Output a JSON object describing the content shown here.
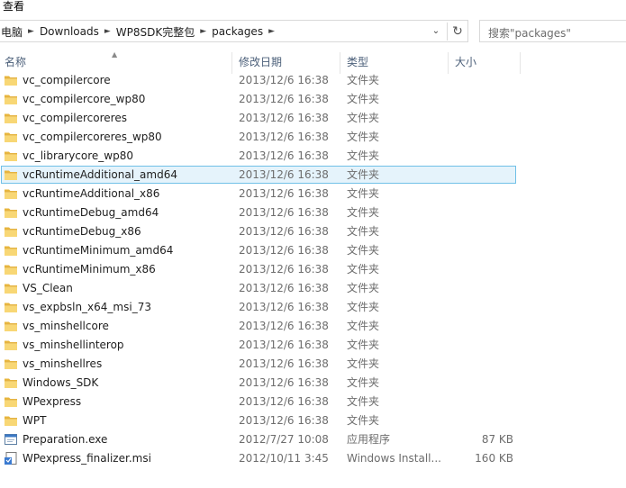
{
  "menu": {
    "view_label": "查看"
  },
  "address": {
    "crumbs": [
      "电脑",
      "Downloads",
      "WP8SDK完整包",
      "packages"
    ],
    "dropdown_icon": "chevron-down-icon",
    "refresh_icon": "refresh-icon"
  },
  "search": {
    "placeholder": "搜索\"packages\""
  },
  "columns": {
    "name": "名称",
    "date": "修改日期",
    "type": "类型",
    "size": "大小"
  },
  "files": [
    {
      "name": "vc_compilercore",
      "date": "2013/12/6 16:38",
      "type": "文件夹",
      "size": "",
      "icon": "folder-icon"
    },
    {
      "name": "vc_compilercore_wp80",
      "date": "2013/12/6 16:38",
      "type": "文件夹",
      "size": "",
      "icon": "folder-icon"
    },
    {
      "name": "vc_compilercoreres",
      "date": "2013/12/6 16:38",
      "type": "文件夹",
      "size": "",
      "icon": "folder-icon"
    },
    {
      "name": "vc_compilercoreres_wp80",
      "date": "2013/12/6 16:38",
      "type": "文件夹",
      "size": "",
      "icon": "folder-icon"
    },
    {
      "name": "vc_librarycore_wp80",
      "date": "2013/12/6 16:38",
      "type": "文件夹",
      "size": "",
      "icon": "folder-icon"
    },
    {
      "name": "vcRuntimeAdditional_amd64",
      "date": "2013/12/6 16:38",
      "type": "文件夹",
      "size": "",
      "icon": "folder-icon",
      "selected": true
    },
    {
      "name": "vcRuntimeAdditional_x86",
      "date": "2013/12/6 16:38",
      "type": "文件夹",
      "size": "",
      "icon": "folder-icon"
    },
    {
      "name": "vcRuntimeDebug_amd64",
      "date": "2013/12/6 16:38",
      "type": "文件夹",
      "size": "",
      "icon": "folder-icon"
    },
    {
      "name": "vcRuntimeDebug_x86",
      "date": "2013/12/6 16:38",
      "type": "文件夹",
      "size": "",
      "icon": "folder-icon"
    },
    {
      "name": "vcRuntimeMinimum_amd64",
      "date": "2013/12/6 16:38",
      "type": "文件夹",
      "size": "",
      "icon": "folder-icon"
    },
    {
      "name": "vcRuntimeMinimum_x86",
      "date": "2013/12/6 16:38",
      "type": "文件夹",
      "size": "",
      "icon": "folder-icon"
    },
    {
      "name": "VS_Clean",
      "date": "2013/12/6 16:38",
      "type": "文件夹",
      "size": "",
      "icon": "folder-icon"
    },
    {
      "name": "vs_expbsln_x64_msi_73",
      "date": "2013/12/6 16:38",
      "type": "文件夹",
      "size": "",
      "icon": "folder-icon"
    },
    {
      "name": "vs_minshellcore",
      "date": "2013/12/6 16:38",
      "type": "文件夹",
      "size": "",
      "icon": "folder-icon"
    },
    {
      "name": "vs_minshellinterop",
      "date": "2013/12/6 16:38",
      "type": "文件夹",
      "size": "",
      "icon": "folder-icon"
    },
    {
      "name": "vs_minshellres",
      "date": "2013/12/6 16:38",
      "type": "文件夹",
      "size": "",
      "icon": "folder-icon"
    },
    {
      "name": "Windows_SDK",
      "date": "2013/12/6 16:38",
      "type": "文件夹",
      "size": "",
      "icon": "folder-icon"
    },
    {
      "name": "WPexpress",
      "date": "2013/12/6 16:38",
      "type": "文件夹",
      "size": "",
      "icon": "folder-icon"
    },
    {
      "name": "WPT",
      "date": "2013/12/6 16:38",
      "type": "文件夹",
      "size": "",
      "icon": "folder-icon"
    },
    {
      "name": "Preparation.exe",
      "date": "2012/7/27 10:08",
      "type": "应用程序",
      "size": "87 KB",
      "icon": "exe-icon"
    },
    {
      "name": "WPexpress_finalizer.msi",
      "date": "2012/10/11 3:45",
      "type": "Windows Install...",
      "size": "160 KB",
      "icon": "msi-icon"
    }
  ]
}
